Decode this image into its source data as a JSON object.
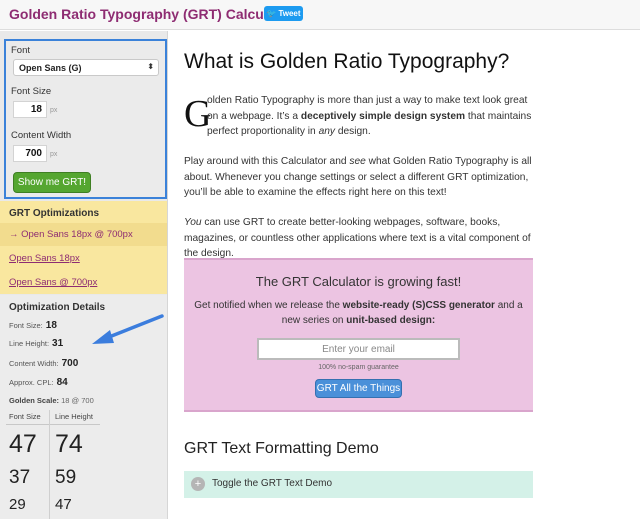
{
  "header": {
    "app_title": "Golden Ratio Typography (GRT) Calculator",
    "tweet_label": "Tweet",
    "tweet_icon": "twitter-bird-icon"
  },
  "sidebar": {
    "font_label": "Font",
    "font_value": "Open Sans (G)",
    "font_size_label": "Font Size",
    "font_size_value": "18",
    "font_size_unit": "px",
    "content_width_label": "Content Width",
    "content_width_value": "700",
    "content_width_unit": "px",
    "show_button": "Show me GRT!",
    "optimizations_title": "GRT Optimizations",
    "optimizations": [
      "→ Open Sans 18px @ 700px",
      "Open Sans 18px",
      "Open Sans @ 700px"
    ],
    "details_title": "Optimization Details",
    "details": {
      "font_size_label": "Font Size:",
      "font_size": "18",
      "line_height_label": "Line Height:",
      "line_height": "31",
      "content_width_label": "Content Width:",
      "content_width": "700",
      "cpl_label": "Approx. CPL:",
      "cpl": "84",
      "golden_scale_label": "Golden Scale:",
      "golden_scale": "18 @ 700"
    },
    "scale_table": {
      "headers": [
        "Font Size",
        "Line Height"
      ],
      "rows": [
        [
          "47",
          "74"
        ],
        [
          "37",
          "59"
        ],
        [
          "29",
          "47"
        ]
      ]
    }
  },
  "main": {
    "title": "What is Golden Ratio Typography?",
    "intro_dropcap": "G",
    "intro_1": "olden Ratio Typography is more than just a way to make text look great on a webpage. It’s a ",
    "intro_bold": "deceptively simple design system",
    "intro_2": " that maintains perfect proportionality in ",
    "intro_em": "any",
    "intro_3": " design.",
    "para2_1": "Play around with this Calculator and ",
    "para2_em": "see",
    "para2_2": " what Golden Ratio Typography is all about. Whenever you change settings or select a different GRT optimization, you’ll be able to examine the effects right here on this text!",
    "para3_em": "You",
    "para3": " can use GRT to create better-looking webpages, software, books, magazines, or countless other applications where text is a vital component of the design.",
    "cta": {
      "title": "The GRT Calculator is growing fast!",
      "text_1": "Get notified when we release the ",
      "text_bold1": "website-ready (S)CSS generator",
      "text_2": " and a new series on ",
      "text_bold2": "unit-based design:",
      "email_placeholder": "Enter your email",
      "guarantee": "100% no-spam guarantee",
      "button": "GRT All the Things"
    },
    "demo_title": "GRT Text Formatting Demo",
    "toggle_label": "Toggle the GRT Text Demo",
    "toggle_icon": "plus-icon"
  },
  "colors": {
    "brand": "#8e2c72",
    "settings_border": "#3b82d9",
    "show_button": "#55a630",
    "optimizations_bg": "#f9e79f",
    "cta_bg": "#ecc4e2",
    "cta_button": "#4a90d9",
    "toggle_bg": "#d4f1e8",
    "annotation_arrow": "#3b7ddd"
  }
}
